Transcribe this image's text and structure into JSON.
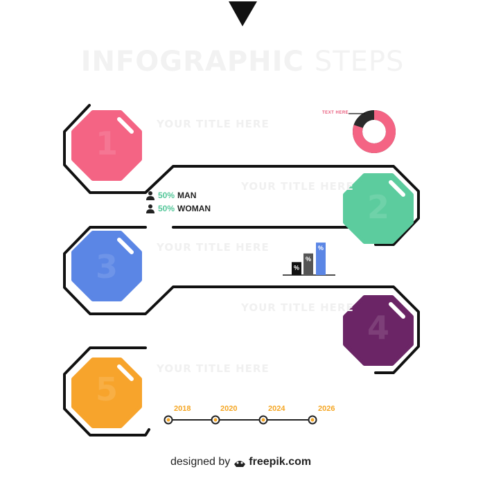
{
  "title": {
    "bold": "INFOGRAPHIC",
    "light": "STEPS"
  },
  "steps": [
    {
      "number": "1",
      "title": "YOUR TITLE HERE",
      "color": "#f46484"
    },
    {
      "number": "2",
      "title": "YOUR TITLE HERE",
      "color": "#5ccc9e"
    },
    {
      "number": "3",
      "title": "YOUR TITLE HERE",
      "color": "#5b86e5"
    },
    {
      "number": "4",
      "title": "YOUR TITLE HERE",
      "color": "#6b2566"
    },
    {
      "number": "5",
      "title": "YOUR TITLE HERE",
      "color": "#f7a42c"
    }
  ],
  "donut": {
    "label": "TEXT HERE",
    "percent": 80,
    "fill_color": "#f46484",
    "rest_color": "#2a2a2a"
  },
  "stats": [
    {
      "icon": "person-icon",
      "value": "50%",
      "label": "MAN"
    },
    {
      "icon": "person-icon",
      "value": "50%",
      "label": "WOMAN"
    }
  ],
  "bars": {
    "label": "%",
    "levels": [
      0.3,
      0.5,
      0.75
    ],
    "colors": [
      "#111111",
      "#555555",
      "#5b86e5"
    ]
  },
  "timeline": {
    "years": [
      "2018",
      "2020",
      "2024",
      "2026"
    ],
    "color": "#f5a623"
  },
  "footer": {
    "designed": "designed by",
    "brand": "freepik.com",
    "icon": "freepik-logo-icon"
  },
  "top_marker": {
    "icon": "triangle-down-icon"
  }
}
